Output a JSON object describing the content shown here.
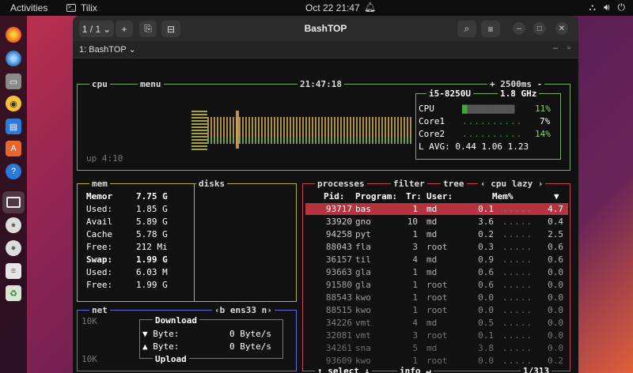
{
  "topbar": {
    "activities": "Activities",
    "app_name": "Tilix",
    "clock": "Oct 22  21:47"
  },
  "window": {
    "title": "BashTOP",
    "session_counter": "1 / 1",
    "tab_label": "1: BashTOP"
  },
  "cpu": {
    "label": "cpu",
    "menu_label": "menu",
    "time": "21:47:18",
    "interval": "2500ms",
    "uptime": "up 4:10",
    "model": "i5-8250U",
    "freq": "1.8 GHz",
    "rows": [
      {
        "name": "CPU",
        "dots": "▇▇▇▇▇▇▇▇▇▇",
        "pct": "11%"
      },
      {
        "name": "Core1",
        "dots": "..........",
        "pct": "7%"
      },
      {
        "name": "Core2",
        "dots": "..........",
        "pct": "14%"
      }
    ],
    "load_avg": "L AVG: 0.44 1.06 1.23"
  },
  "mem": {
    "label": "mem",
    "disks_label": "disks",
    "rows": [
      {
        "name": "Memor",
        "value": "7.75 G",
        "bold": true
      },
      {
        "name": "Used:",
        "value": "1.85 G"
      },
      {
        "name": "Avail",
        "value": "5.89 G"
      },
      {
        "name": "Cache",
        "value": "5.78 G"
      },
      {
        "name": "Free:",
        "value": "212 Mi"
      },
      {
        "name": "Swap:",
        "value": "1.99 G",
        "bold": true
      },
      {
        "name": "Used:",
        "value": "6.03 M"
      },
      {
        "name": "Free:",
        "value": "1.99 G"
      }
    ]
  },
  "net": {
    "label": "net",
    "iface": "‹b ens33 n›",
    "scale_top": "10K",
    "scale_bottom": "10K",
    "download": "Download",
    "byte_down": "▼ Byte:",
    "down_val": "0 Byte/s",
    "byte_up": "▲ Byte:",
    "up_val": "0 Byte/s",
    "upload": "Upload"
  },
  "proc": {
    "label": "processes",
    "filter": "filter",
    "tree": "tree",
    "sort": "‹ cpu lazy ›",
    "headers": {
      "pid": "Pid:",
      "program": "Program:",
      "tr": "Tr:",
      "user": "User:",
      "mem": "Mem%",
      "cpu": "▼"
    },
    "rows": [
      {
        "pid": "93717",
        "prog": "bas",
        "tr": "1",
        "user": "md",
        "mem": "0.1",
        "dots": ".....",
        "cpu": "4.7",
        "sel": true
      },
      {
        "pid": "33920",
        "prog": "gno",
        "tr": "10",
        "user": "md",
        "mem": "3.6",
        "dots": ".....",
        "cpu": "0.4"
      },
      {
        "pid": "94258",
        "prog": "pyt",
        "tr": "1",
        "user": "md",
        "mem": "0.2",
        "dots": ".....",
        "cpu": "2.5"
      },
      {
        "pid": "88043",
        "prog": "fla",
        "tr": "3",
        "user": "root",
        "mem": "0.3",
        "dots": ".....",
        "cpu": "0.6"
      },
      {
        "pid": "36157",
        "prog": "til",
        "tr": "4",
        "user": "md",
        "mem": "0.9",
        "dots": ".....",
        "cpu": "0.6"
      },
      {
        "pid": "93663",
        "prog": "gla",
        "tr": "1",
        "user": "md",
        "mem": "0.6",
        "dots": ".....",
        "cpu": "0.0"
      },
      {
        "pid": "91580",
        "prog": "gla",
        "tr": "1",
        "user": "root",
        "mem": "0.6",
        "dots": ".....",
        "cpu": "0.0"
      },
      {
        "pid": "88543",
        "prog": "kwo",
        "tr": "1",
        "user": "root",
        "mem": "0.0",
        "dots": ".....",
        "cpu": "0.0"
      },
      {
        "pid": "88515",
        "prog": "kwo",
        "tr": "1",
        "user": "root",
        "mem": "0.0",
        "dots": ".....",
        "cpu": "0.0"
      },
      {
        "pid": "34226",
        "prog": "vmt",
        "tr": "4",
        "user": "md",
        "mem": "0.5",
        "dots": ".....",
        "cpu": "0.0"
      },
      {
        "pid": "32081",
        "prog": "vmt",
        "tr": "3",
        "user": "root",
        "mem": "0.1",
        "dots": ".....",
        "cpu": "0.0"
      },
      {
        "pid": "34261",
        "prog": "sna",
        "tr": "5",
        "user": "md",
        "mem": "3.8",
        "dots": ".....",
        "cpu": "0.0"
      },
      {
        "pid": "93609",
        "prog": "kwo",
        "tr": "1",
        "user": "root",
        "mem": "0.0",
        "dots": ".....",
        "cpu": "0.2"
      }
    ],
    "select": "↑ select ↓",
    "info": "info ↵",
    "count": "1/313"
  },
  "colors": {
    "cpu_box": "#7fa876",
    "mem_box": "#b8b24a",
    "net_box": "#6470d8",
    "proc_box": "#c4455a",
    "selected_row": "#b5333f"
  }
}
